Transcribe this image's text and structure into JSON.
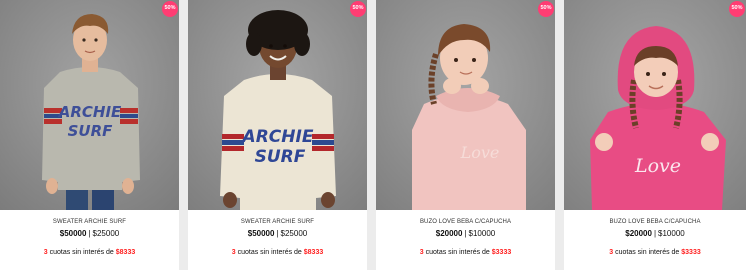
{
  "colors": {
    "badge": "#ff3d73",
    "installment_accent": "#ff2020",
    "page_background": "#ececec",
    "card_background": "#ffffff"
  },
  "products": [
    {
      "badge": "50%",
      "name": "SWEATER ARCHIE SURF",
      "original_price": "$50000",
      "separator": "|",
      "sale_price": "$25000",
      "installments_count": "3",
      "installments_text": "cuotas sin interés de",
      "installment_amount": "$8333",
      "image": "child-in-grey-archie-surf-sweater"
    },
    {
      "badge": "50%",
      "name": "SWEATER ARCHIE SURF",
      "original_price": "$50000",
      "separator": "|",
      "sale_price": "$25000",
      "installments_count": "3",
      "installments_text": "cuotas sin interés de",
      "installment_amount": "$8333",
      "image": "child-in-cream-archie-surf-sweater"
    },
    {
      "badge": "50%",
      "name": "BUZO LOVE BEBA C/CAPUCHA",
      "original_price": "$20000",
      "separator": "|",
      "sale_price": "$10000",
      "installments_count": "3",
      "installments_text": "cuotas sin interés de",
      "installment_amount": "$3333",
      "image": "girl-in-light-pink-hoodie"
    },
    {
      "badge": "50%",
      "name": "BUZO LOVE BEBA C/CAPUCHA",
      "original_price": "$20000",
      "separator": "|",
      "sale_price": "$10000",
      "installments_count": "3",
      "installments_text": "cuotas sin interés de",
      "installment_amount": "$3333",
      "image": "girl-in-hot-pink-love-hoodie"
    }
  ],
  "image_labels": {
    "sweater_line1": "ARCHIE",
    "sweater_line2": "SURF",
    "hoodie_print": "Love"
  }
}
